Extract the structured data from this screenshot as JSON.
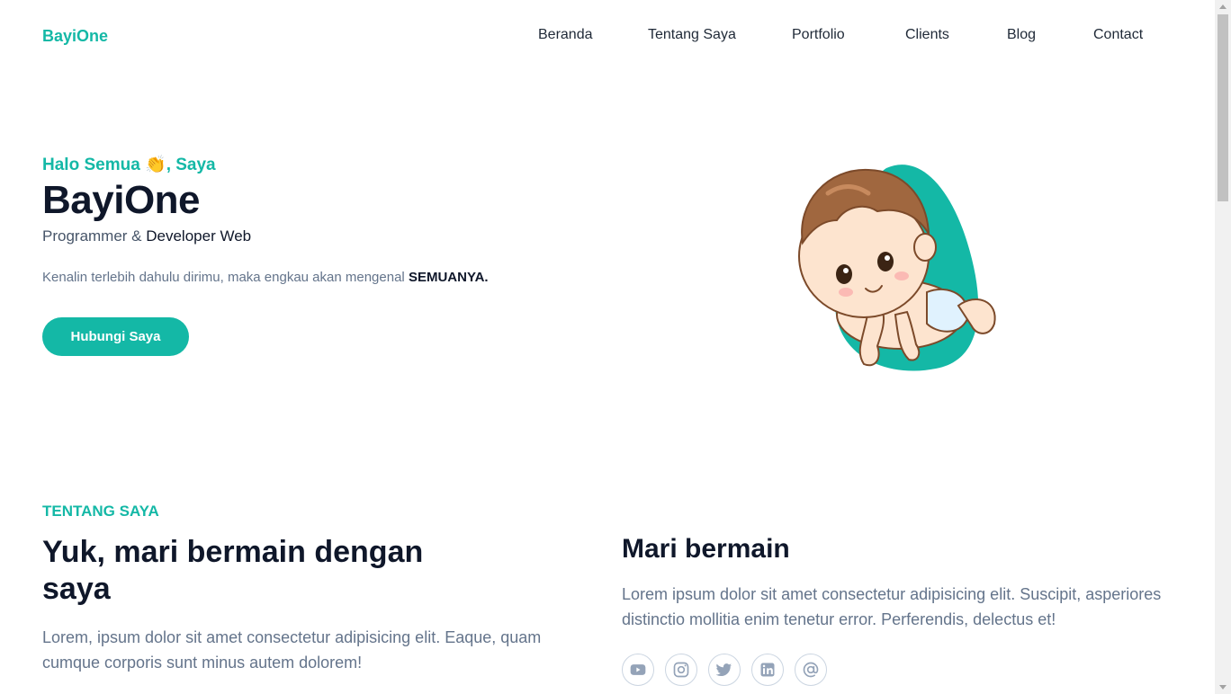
{
  "header": {
    "brand": "BayiOne",
    "nav": [
      "Beranda",
      "Tentang Saya",
      "Portfolio",
      "Clients",
      "Blog",
      "Contact"
    ]
  },
  "hero": {
    "greeting": "Halo Semua 👏, Saya",
    "name": "BayiOne",
    "role_prefix": "Programmer & ",
    "role_strong": "Developer Web",
    "desc": "Kenalin terlebih dahulu dirimu, maka engkau akan mengenal ",
    "desc_strong": "SEMUANYA.",
    "cta": "Hubungi Saya"
  },
  "about": {
    "kicker": "TENTANG SAYA",
    "title": "Yuk, mari bermain dengan saya",
    "text": "Lorem, ipsum dolor sit amet consectetur adipisicing elit. Eaque, quam cumque corporis sunt minus autem dolorem!",
    "play_title": "Mari bermain",
    "play_text": "Lorem ipsum dolor sit amet consectetur adipisicing elit. Suscipit, asperiores distinctio mollitia enim tenetur error. Perferendis, delectus et!",
    "socials": [
      "youtube-icon",
      "instagram-icon",
      "twitter-icon",
      "linkedin-icon",
      "at-icon"
    ]
  },
  "colors": {
    "accent": "#14b8a6",
    "text_dark": "#0f172a",
    "text_muted": "#64748b"
  }
}
